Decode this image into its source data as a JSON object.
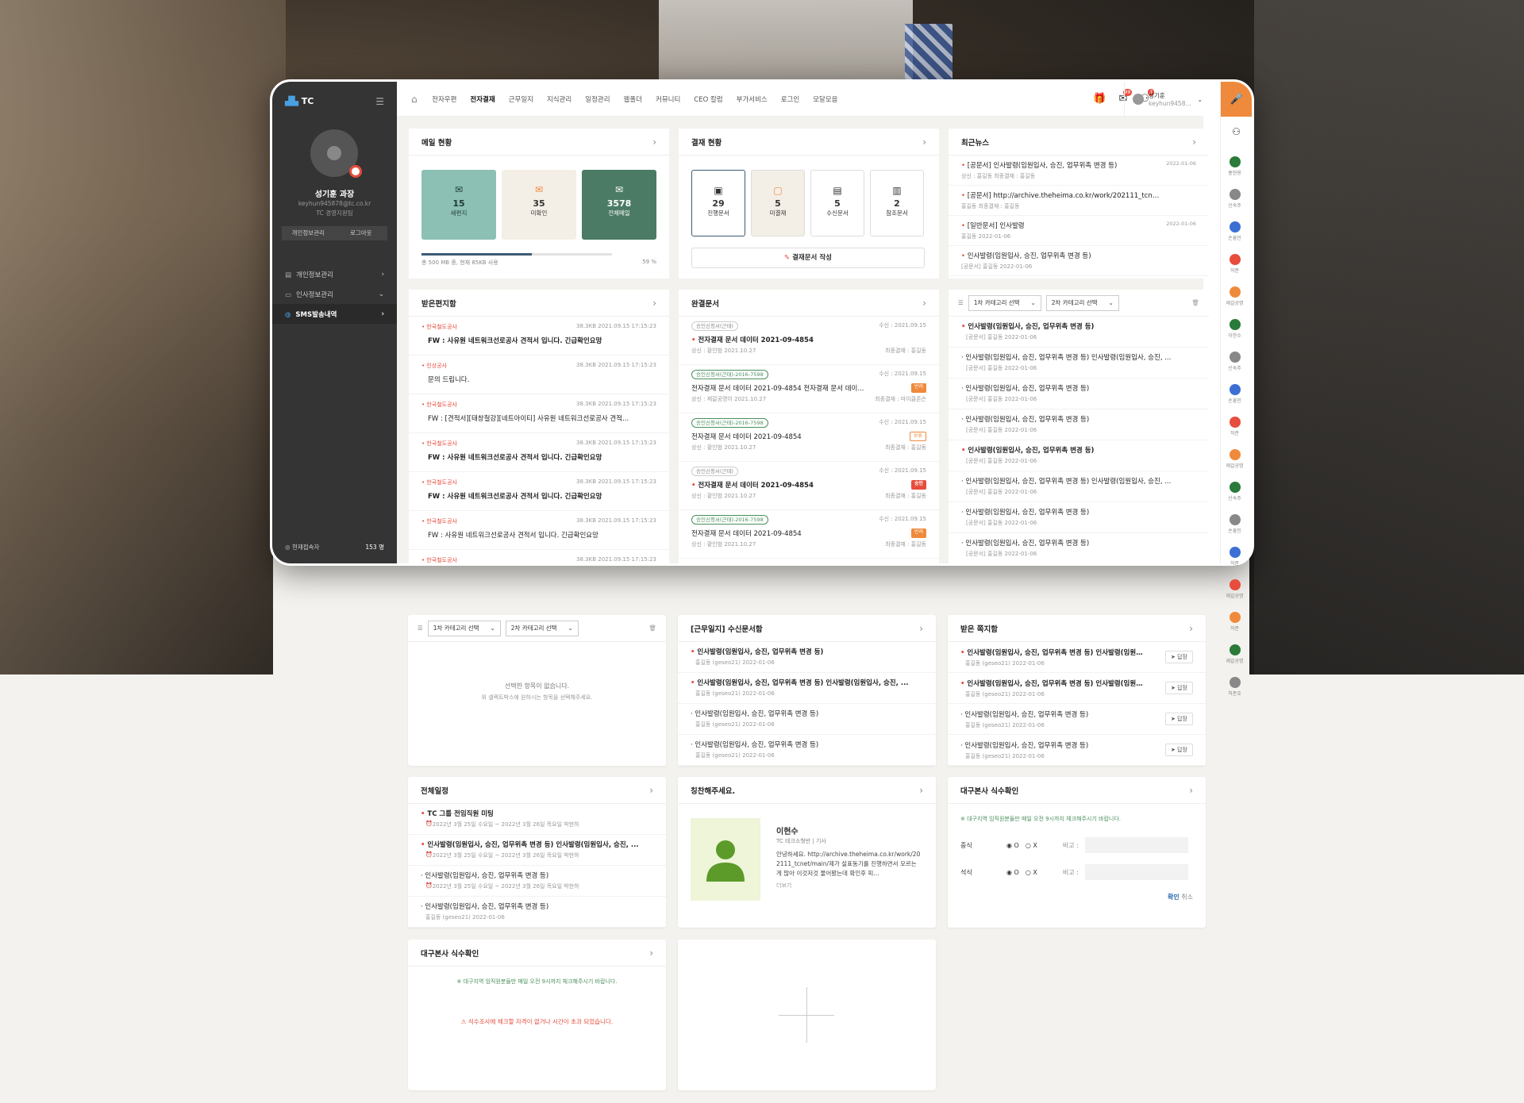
{
  "sidebar": {
    "logo": "TC",
    "user_name": "성기훈 과장",
    "user_email": "keyhun945878@tc.co.kr",
    "user_dept": "TC 경영지원팀",
    "btn_profile": "개인정보관리",
    "btn_logout": "로그아웃",
    "menu": [
      {
        "label": "개인정보관리"
      },
      {
        "label": "인사정보관리"
      },
      {
        "label": "SMS발송내역"
      }
    ],
    "online_label": "현재접속자",
    "online_count": "153 명"
  },
  "topnav": {
    "items": [
      "전자우편",
      "전자결재",
      "근무일지",
      "지식관리",
      "일정관리",
      "웹폴더",
      "커뮤니티",
      "CEO 칼럼",
      "부가서비스",
      "로그인",
      "모달모음"
    ],
    "mail_badge": "99",
    "alarm_badge": "3",
    "user_name": "성기훈",
    "user_sub": "keyhun9458..."
  },
  "mail_status": {
    "title": "메일 현황",
    "new_n": "15",
    "new_l": "새편지",
    "unread_n": "35",
    "unread_l": "미확인",
    "all_n": "3578",
    "all_l": "전체메일",
    "usage": "총 500 MB 중, 현재 85KB 사용",
    "pct": "59 %",
    "bar_fraction": 0.58
  },
  "approval_status": {
    "title": "결재 현황",
    "items": [
      {
        "n": "29",
        "l": "진행문서"
      },
      {
        "n": "5",
        "l": "미결재"
      },
      {
        "n": "5",
        "l": "수신문서"
      },
      {
        "n": "2",
        "l": "참조문서"
      }
    ],
    "write": "결재문서 작성"
  },
  "news": {
    "title": "최근뉴스",
    "items": [
      {
        "t": "[공문서] 인사발령(임원입사, 승진, 업무위촉 변경 등)",
        "m": "상신 : 홍길동   최종결재 : 홍길동",
        "d": "2022-01-06"
      },
      {
        "t": "[공문서] http://archive.theheima.co.kr/work/202111_tcnet/main/",
        "m": "홍길동   최종결재 : 홍길동",
        "d": ""
      },
      {
        "t": "[일반문서] 인사발령",
        "m": "홍길동   2022-01-06",
        "d": "2022-01-06"
      },
      {
        "t": "인사발령(임원입사, 승진, 업무위촉 변경 등)",
        "m": "[공문서] 홍길동   2022-01-06",
        "d": ""
      }
    ]
  },
  "inbox": {
    "title": "받은편지함",
    "items": [
      {
        "from": "한국철도공사",
        "t": "FW : 사유원 네트워크선로공사 견적서 입니다. 긴급확인요망",
        "size": "38.3KB",
        "d": "2021.09.15 17:15:23"
      },
      {
        "from": "인상공사",
        "t": "문의 드립니다.",
        "size": "38.3KB",
        "d": "2021.09.15 17:15:23"
      },
      {
        "from": "한국철도공사",
        "t": "FW : [견적서][태창철강][네트아이티] 사유원 네트워크선로공사 견적...",
        "size": "38.3KB",
        "d": "2021.09.15 17:15:23"
      },
      {
        "from": "한국철도공사",
        "t": "FW : 사유원 네트워크선로공사 견적서 입니다. 긴급확인요망",
        "size": "38.3KB",
        "d": "2021.09.15 17:15:23"
      },
      {
        "from": "한국철도공사",
        "t": "FW : 사유원 네트워크선로공사 견적서 입니다. 긴급확인요망",
        "size": "38.3KB",
        "d": "2021.09.15 17:15:23"
      },
      {
        "from": "한국철도공사",
        "t": "FW : 사유원 네트워크선로공사 견적서 입니다. 긴급확인요망",
        "size": "38.3KB",
        "d": "2021.09.15 17:15:23"
      },
      {
        "from": "한국철도공사",
        "t": "FW : 사유원 네트워크선로공사 견적서 입니다. 긴급확인요망",
        "size": "38.3KB",
        "d": "2021.09.15 17:15:23"
      }
    ]
  },
  "done_docs": {
    "title": "완결문서",
    "items": [
      {
        "tag": "승인신청서(근태)",
        "t": "전자결재 문서 데이터 2021-09-4854",
        "m": "상신 : 황인범   2021.10.27",
        "r": "최종결재 : 홍길동",
        "d": "수신 : 2021.09.15",
        "badge": ""
      },
      {
        "tag": "승인신청서(근태)-2016-7598",
        "t": "전자결재 문서 데이터 2021-09-4854 전자결재 문서 데이...",
        "m": "상신 : 제갈공명이   2021.10.27",
        "r": "최종결재 : 마이클존슨",
        "d": "수신 : 2021.09.15",
        "badge": "반려"
      },
      {
        "tag": "승인신청서(근태)-2016-7598",
        "t": "전자결재 문서 데이터 2021-09-4854",
        "m": "상신 : 황인범   2021.10.27",
        "r": "최종결재 : 홍길동",
        "d": "수신 : 2021.09.15",
        "badge": "보류"
      },
      {
        "tag": "승인신청서(근태)",
        "t": "전자결재 문서 데이터 2021-09-4854",
        "m": "상신 : 황인범   2021.10.27",
        "r": "최종결재 : 홍길동",
        "d": "수신 : 2021.09.15",
        "badge": "승인"
      },
      {
        "tag": "승인신청서(근태)-2016-7598",
        "t": "전자결재 문서 데이터 2021-09-4854",
        "m": "상신 : 황인범   2021.10.27",
        "r": "최종결재 : 홍길동",
        "d": "수신 : 2021.09.15",
        "badge": "반려"
      }
    ]
  },
  "board": {
    "sel1": "1차 카테고리 선택",
    "sel2": "2차 카테고리 선택",
    "items": [
      {
        "t": "인사발령(임원입사, 승진, 업무위촉 변경 등)",
        "m": "[공문서] 홍길동   2022-01-06"
      },
      {
        "t": "인사발령(임원입사, 승진, 업무위촉 변경 등) 인사발령(임원입사, 승진, ...",
        "m": "[공문서] 홍길동   2022-01-06"
      },
      {
        "t": "인사발령(임원입사, 승진, 업무위촉 변경 등)",
        "m": "[공문서] 홍길동   2022-01-06"
      },
      {
        "t": "인사발령(임원입사, 승진, 업무위촉 변경 등)",
        "m": "[공문서] 홍길동   2022-01-06"
      },
      {
        "t": "인사발령(임원입사, 승진, 업무위촉 변경 등)",
        "m": "[공문서] 홍길동   2022-01-06"
      },
      {
        "t": "인사발령(임원입사, 승진, 업무위촉 변경 등) 인사발령(임원입사, 승진, ...",
        "m": "[공문서] 홍길동   2022-01-06"
      },
      {
        "t": "인사발령(임원입사, 승진, 업무위촉 변경 등)",
        "m": "[공문서] 홍길동   2022-01-06"
      },
      {
        "t": "인사발령(임원입사, 승진, 업무위촉 변경 등)",
        "m": "[공문서] 홍길동   2022-01-06"
      },
      {
        "t": "인사발령(임원입사, 승진, 업무위촉 변경 등)",
        "m": "[공문서] 홍길동   2022-01-06"
      }
    ]
  },
  "empty_board": {
    "msg": "선택한 항목이 없습니다.",
    "sub": "위 셀렉트박스에 원하시는 항목을 선택해주세요."
  },
  "work_recv": {
    "title": "[근무일지] 수신문서함",
    "items": [
      {
        "t": "인사발령(임원입사, 승진, 업무위촉 변경 등)",
        "m": "홍길동 (geseo21)   2022-01-06"
      },
      {
        "t": "인사발령(임원입사, 승진, 업무위촉 변경 등) 인사발령(임원입사, 승진, ...",
        "m": "홍길동 (geseo21)   2022-01-06"
      },
      {
        "t": "인사발령(임원입사, 승진, 업무위촉 변경 등)",
        "m": "홍길동 (geseo21)   2022-01-06"
      },
      {
        "t": "인사발령(임원입사, 승진, 업무위촉 변경 등)",
        "m": "홍길동 (geseo21)   2022-01-06"
      }
    ]
  },
  "notes": {
    "title": "받은 쪽지함",
    "reply": "답장",
    "items": [
      {
        "t": "인사발령(임원입사, 승진, 업무위촉 변경 등) 인사발령(임원...",
        "m": "홍길동 (geseo21)   2022-01-06"
      },
      {
        "t": "인사발령(임원입사, 승진, 업무위촉 변경 등) 인사발령(임원...",
        "m": "홍길동 (geseo21)   2022-01-06"
      },
      {
        "t": "인사발령(임원입사, 승진, 업무위촉 변경 등)",
        "m": "홍길동 (geseo21)   2022-01-06"
      },
      {
        "t": "인사발령(임원입사, 승진, 업무위촉 변경 등)",
        "m": "홍길동 (geseo21)   2022-01-06"
      }
    ]
  },
  "schedule": {
    "title": "전체일정",
    "items": [
      {
        "t": "TC 그룹 전임직원 미팅",
        "m": "2022년 3월 25일 수요일 ~ 2022년 3월 26일 목요일   박현하"
      },
      {
        "t": "인사발령(임원입사, 승진, 업무위촉 변경 등) 인사발령(임원입사, 승진, ...",
        "m": "2022년 3월 25일 수요일 ~ 2022년 3월 26일 목요일   박현하"
      },
      {
        "t": "인사발령(임원입사, 승진, 업무위촉 변경 등)",
        "m": "2022년 3월 25일 수요일 ~ 2022년 3월 26일 목요일   박현하"
      },
      {
        "t": "인사발령(임원입사, 승진, 업무위촉 변경 등)",
        "m": "홍길동 (geseo21)   2022-01-06"
      }
    ]
  },
  "praise": {
    "title": "칭찬해주세요.",
    "name": "이현수",
    "dept": "TC 테크소형반  |  기사",
    "body": "안녕하세요. http://archive.theheima.co.kr/work/202111_tcnet/main/제가 설표동기를 진행하면서 모르는 게 많아 이것저것 물어봤는데 확인후 피...",
    "more": "더보기"
  },
  "meal": {
    "title": "대구본사 식수확인",
    "notice": "※ 대구지역 임직원분들만 매일 오전 9시까지 체크해주시기 바랍니다.",
    "lunch": "중식",
    "dinner": "석식",
    "o": "O",
    "x": "X",
    "memo": "비고 :",
    "ok": "확인",
    "cancel": "취소"
  },
  "meal2": {
    "title": "대구본사 식수확인",
    "notice": "※ 대구지역 임직원분들만 매일 오전 9시까지 체크해주시기 바랍니다.",
    "warn": "식수조사에 체크할 자격이 없거나 시간이 초과 되었습니다."
  },
  "people": [
    "홍현용",
    "신숙주",
    "손흥민",
    "허준",
    "제갈공명",
    "이한수",
    "신숙주",
    "손흥민",
    "허준",
    "제갈공명",
    "신숙주",
    "손흥민",
    "허준",
    "제갈공명",
    "허준",
    "제갈공명",
    "허준호"
  ]
}
